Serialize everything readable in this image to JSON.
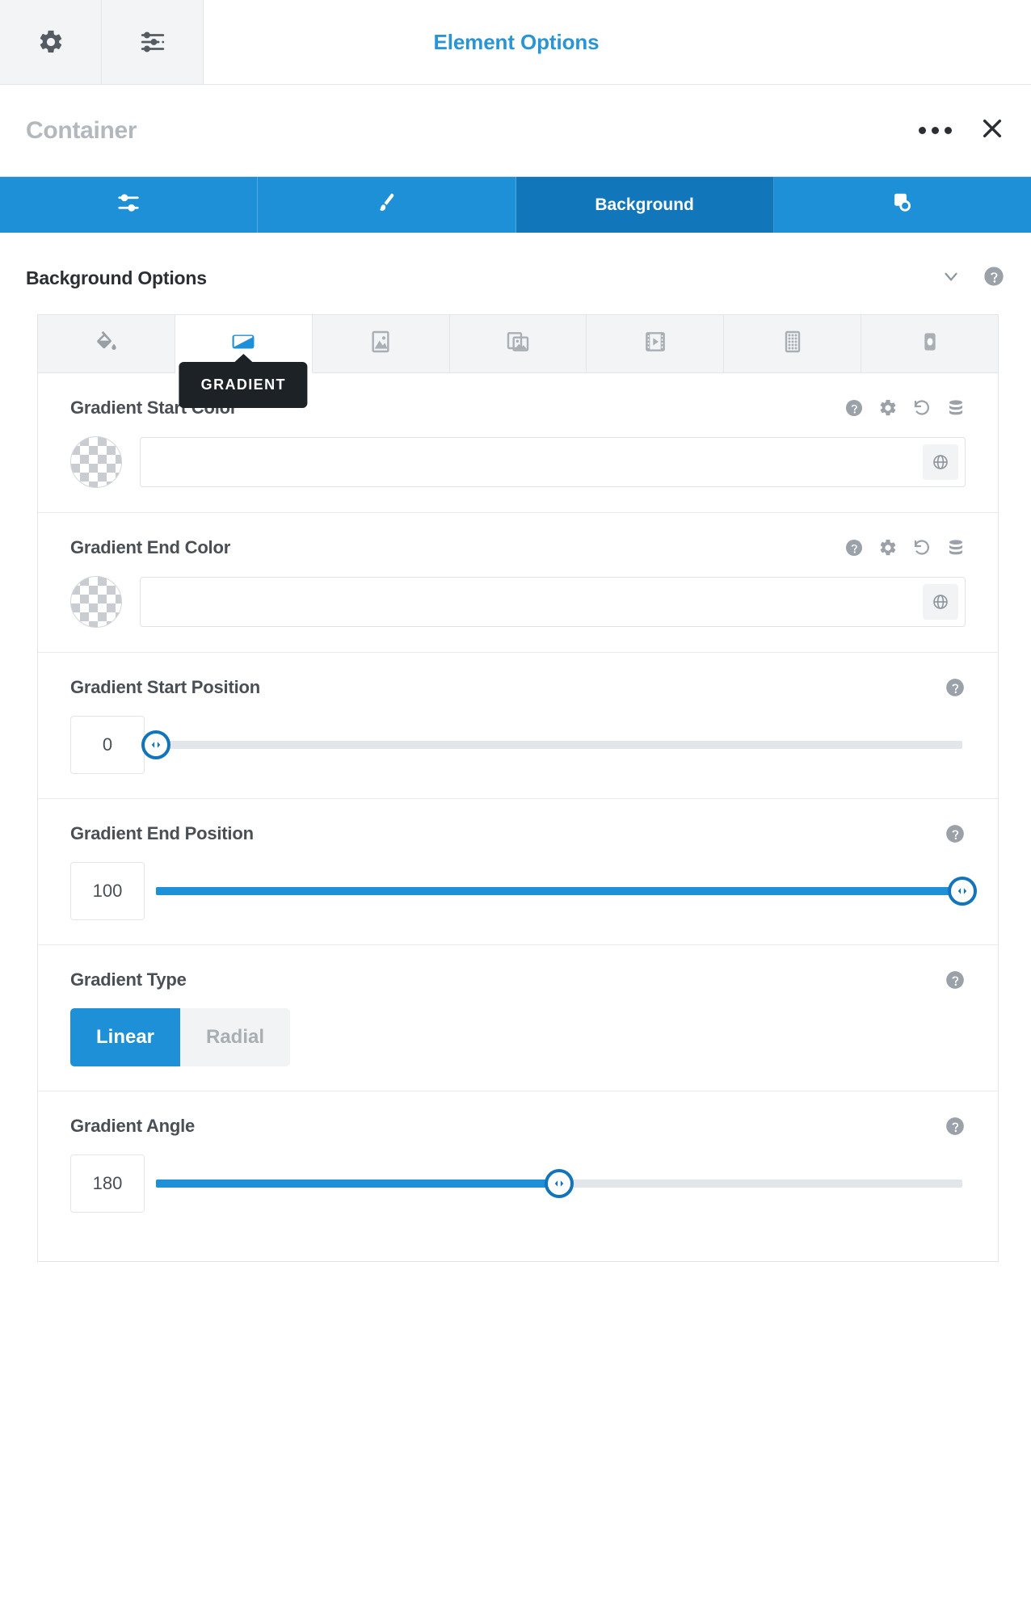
{
  "toolbar": {
    "buttons": [
      {
        "name": "gear-icon",
        "label": "Settings"
      },
      {
        "name": "sliders-icon",
        "label": "Adjustments"
      }
    ],
    "title": "Element Options"
  },
  "element_header": {
    "title": "Container",
    "more_label": "More options",
    "close_label": "Close"
  },
  "tabs": [
    {
      "label": "",
      "icon": "sliders-icon",
      "active": false
    },
    {
      "label": "",
      "icon": "brush-icon",
      "active": false
    },
    {
      "label": "Background",
      "icon": "",
      "active": true
    },
    {
      "label": "",
      "icon": "layers-copy-icon",
      "active": false
    }
  ],
  "section": {
    "title": "Background Options"
  },
  "background_types": [
    {
      "name": "color",
      "icon": "paint-bucket-icon",
      "active": false
    },
    {
      "name": "gradient",
      "icon": "gradient-icon",
      "active": true,
      "tooltip": "GRADIENT"
    },
    {
      "name": "image",
      "icon": "image-icon",
      "active": false
    },
    {
      "name": "parallax",
      "icon": "image-stack-icon",
      "active": false
    },
    {
      "name": "video",
      "icon": "film-icon",
      "active": false
    },
    {
      "name": "pattern",
      "icon": "pattern-grid-icon",
      "active": false
    },
    {
      "name": "mask",
      "icon": "mask-icon",
      "active": false
    }
  ],
  "options": {
    "gradient_start_color": {
      "label": "Gradient Start Color",
      "value": "",
      "placeholder": "",
      "swatch": "transparent"
    },
    "gradient_end_color": {
      "label": "Gradient End Color",
      "value": "",
      "placeholder": "",
      "swatch": "transparent"
    },
    "gradient_start_position": {
      "label": "Gradient Start Position",
      "value": "0",
      "percent": 0
    },
    "gradient_end_position": {
      "label": "Gradient End Position",
      "value": "100",
      "percent": 100
    },
    "gradient_type": {
      "label": "Gradient Type",
      "options": [
        "Linear",
        "Radial"
      ],
      "selected": "Linear"
    },
    "gradient_angle": {
      "label": "Gradient Angle",
      "value": "180",
      "percent": 50
    }
  },
  "colors": {
    "accent_blue": "#1e90d8",
    "accent_blue_dark": "#1276bb",
    "title_blue": "#2a95d5",
    "tooltip_bg": "#1d2226",
    "text_dark": "#2b2f33",
    "text_muted": "#4a4f55",
    "text_light": "#b3b8bd",
    "border": "#e2e6ea",
    "panel_bg": "#f3f4f6"
  }
}
